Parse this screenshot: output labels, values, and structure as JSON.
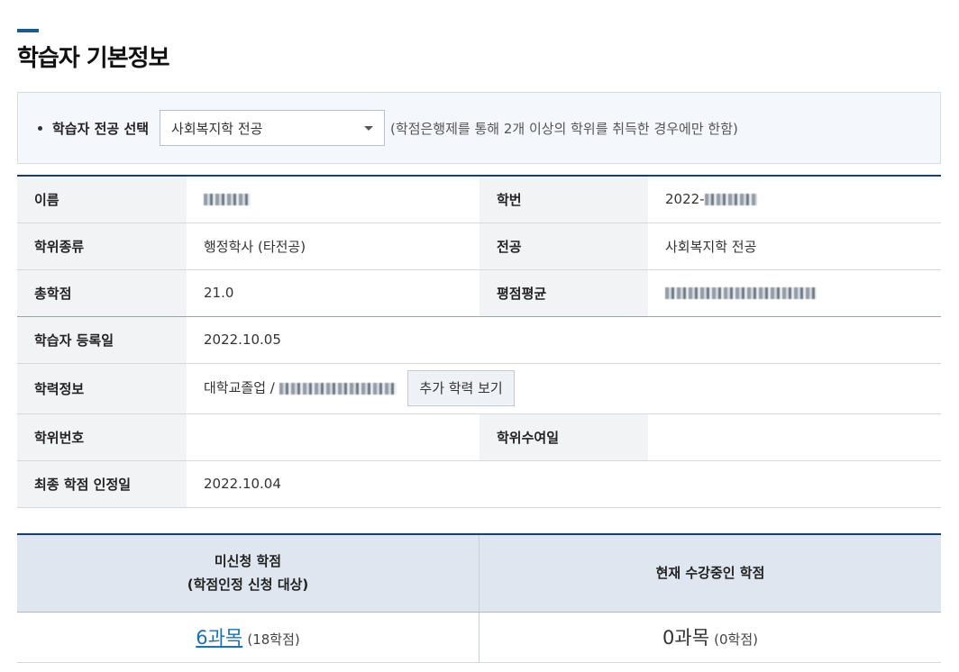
{
  "page": {
    "title": "학습자 기본정보"
  },
  "major": {
    "label": "학습자 전공 선택",
    "selected": "사회복지학 전공",
    "note": "(학점은행제를 통해 2개 이상의 학위를 취득한 경우에만 한함)"
  },
  "info": {
    "name_label": "이름",
    "student_id_label": "학번",
    "student_id_prefix": "2022-",
    "degree_type_label": "학위종류",
    "degree_type_value": "행정학사 (타전공)",
    "major_label": "전공",
    "major_value": "사회복지학 전공",
    "total_credits_label": "총학점",
    "total_credits_value": "21.0",
    "gpa_label": "평점평균",
    "registration_date_label": "학습자 등록일",
    "registration_date_value": "2022.10.05",
    "education_label": "학력정보",
    "education_prefix": "대학교졸업 /",
    "more_education_button": "추가 학력 보기",
    "degree_number_label": "학위번호",
    "degree_award_date_label": "학위수여일",
    "final_credit_date_label": "최종 학점 인정일",
    "final_credit_date_value": "2022.10.04"
  },
  "credits": {
    "unapplied_header_line1": "미신청 학점",
    "unapplied_header_line2": "(학점인정 신청 대상)",
    "current_header": "현재 수강중인 학점",
    "unapplied_count": "6과목",
    "unapplied_sub": "(18학점)",
    "current_count": "0과목",
    "current_sub": "(0학점)"
  }
}
